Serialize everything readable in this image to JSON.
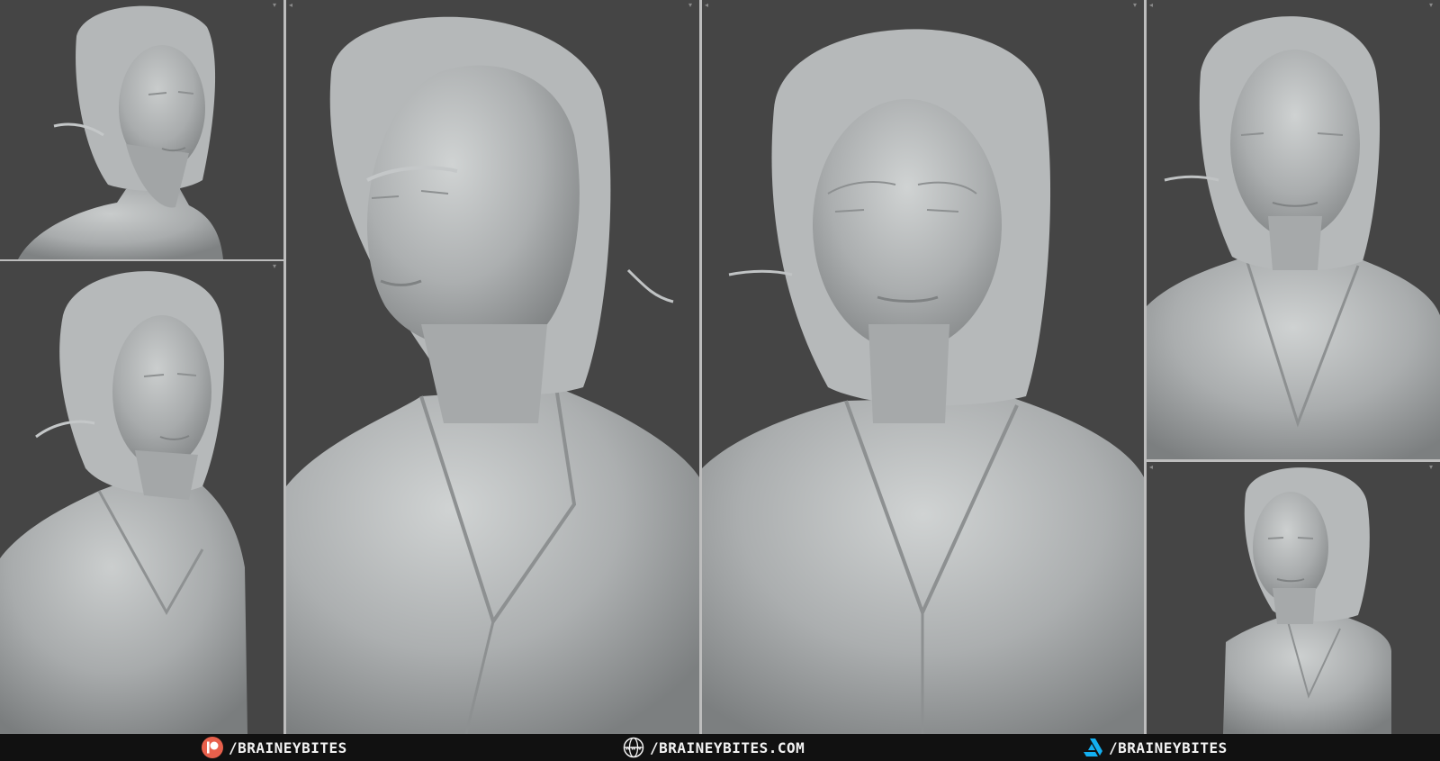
{
  "layout": {
    "background_color": "#454545",
    "divider_color": "#bdbdbd",
    "footer_color": "#111111"
  },
  "viewports": [
    {
      "id": "top-left",
      "subject": "bust-three-quarter-left"
    },
    {
      "id": "bottom-left",
      "subject": "bust-three-quarter-left-closer"
    },
    {
      "id": "center-left",
      "subject": "bust-closeup-three-quarter"
    },
    {
      "id": "center-right",
      "subject": "bust-closeup-front"
    },
    {
      "id": "top-right",
      "subject": "bust-front"
    },
    {
      "id": "bottom-right",
      "subject": "bust-three-quarter-small"
    }
  ],
  "footer": {
    "patreon": {
      "icon": "patreon-icon",
      "color": "#e8604c",
      "label": "/BRAINEYBITES"
    },
    "website": {
      "icon": "globe-icon",
      "label": "/BRAINEYBITES.COM"
    },
    "artstation": {
      "icon": "artstation-icon",
      "color": "#13aff0",
      "label": "/BRAINEYBITES"
    }
  }
}
